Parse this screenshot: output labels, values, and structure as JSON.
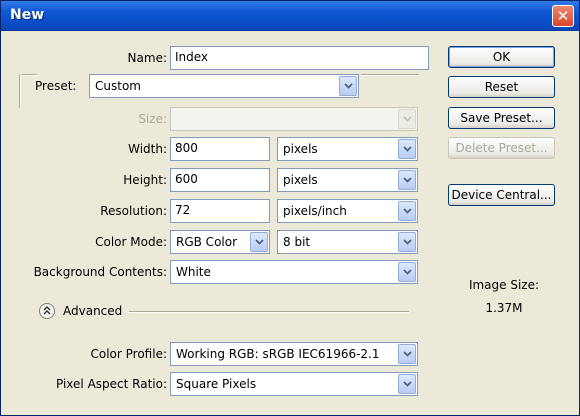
{
  "window": {
    "title": "New",
    "close_glyph": "✕"
  },
  "form": {
    "name_label": "Name:",
    "name_value": "Index",
    "preset_label": "Preset:",
    "preset_value": "Custom",
    "size_label": "Size:",
    "size_value": "",
    "width_label": "Width:",
    "width_value": "800",
    "width_unit": "pixels",
    "height_label": "Height:",
    "height_value": "600",
    "height_unit": "pixels",
    "resolution_label": "Resolution:",
    "resolution_value": "72",
    "resolution_unit": "pixels/inch",
    "colormode_label": "Color Mode:",
    "colormode_value": "RGB Color",
    "bitdepth_value": "8 bit",
    "background_label": "Background Contents:",
    "background_value": "White",
    "advanced_label": "Advanced",
    "colorprofile_label": "Color Profile:",
    "colorprofile_value": "Working RGB:  sRGB IEC61966-2.1",
    "pixelaspect_label": "Pixel Aspect Ratio:",
    "pixelaspect_value": "Square Pixels"
  },
  "buttons": {
    "ok": "OK",
    "reset": "Reset",
    "save_preset": "Save Preset...",
    "delete_preset": "Delete Preset...",
    "device_central": "Device Central..."
  },
  "info": {
    "image_size_label": "Image Size:",
    "image_size_value": "1.37M"
  },
  "colors": {
    "title_bar": "#0a4ec8",
    "dialog_bg": "#ece9d8",
    "close": "#d9452a"
  }
}
